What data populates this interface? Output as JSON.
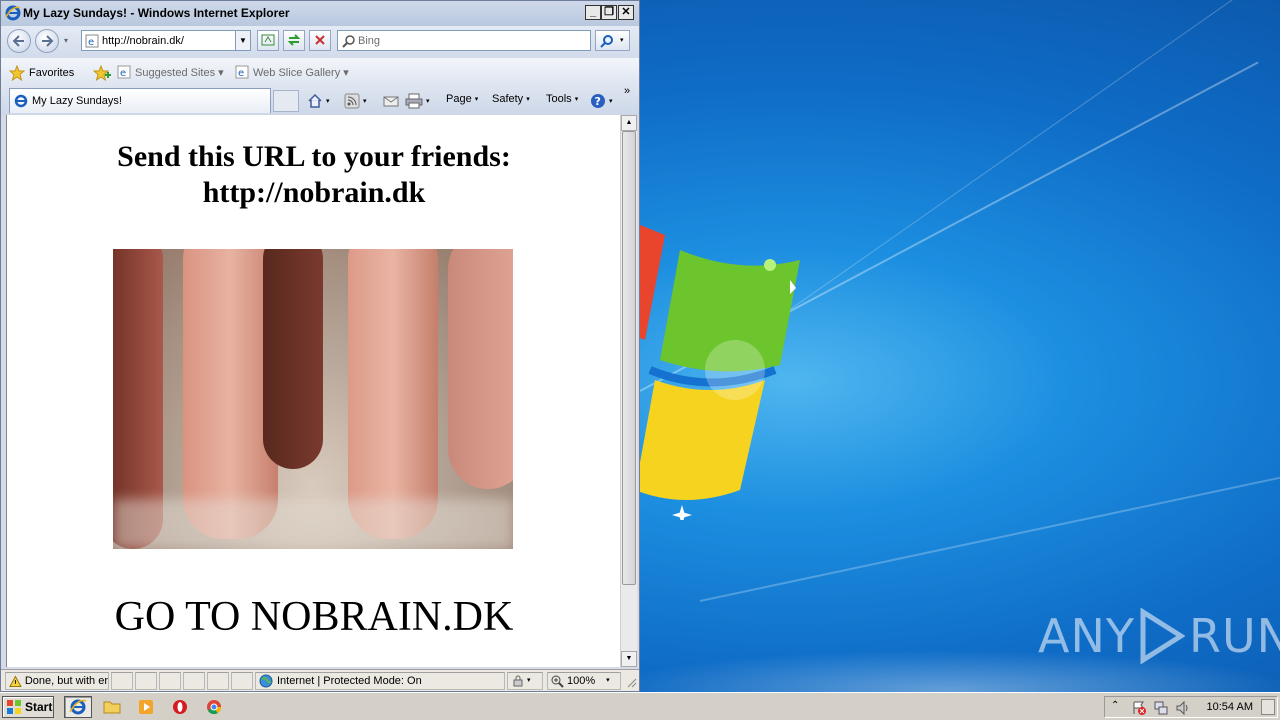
{
  "window": {
    "title": "My Lazy Sundays! - Windows Internet Explorer",
    "minimize_label": "_",
    "restore_label": "❐",
    "close_label": "✕"
  },
  "navbar": {
    "address": "http://nobrain.dk/",
    "search_placeholder": "Bing"
  },
  "favorites_bar": {
    "favorites_label": "Favorites",
    "items": [
      {
        "label": "Suggested Sites ▾"
      },
      {
        "label": "Web Slice Gallery ▾"
      }
    ]
  },
  "tab": {
    "label": "My Lazy Sundays!"
  },
  "command_bar": {
    "page_label": "Page",
    "safety_label": "Safety",
    "tools_label": "Tools",
    "overflow_label": "»"
  },
  "page": {
    "heading_line1": "Send this URL to your friends:",
    "heading_line2": "http://nobrain.dk",
    "goto_text": "GO TO NOBRAIN.DK"
  },
  "status_bar": {
    "status_text": "Done, but with er",
    "zone_text": "Internet | Protected Mode: On",
    "zoom": "100%"
  },
  "taskbar": {
    "start_label": "Start",
    "clock": "10:54 AM"
  },
  "watermark": {
    "text_left": "ANY",
    "text_right": "RUN"
  },
  "colors": {
    "desktop_blue": "#0f6cc6",
    "ie_chrome": "#d6dbe9",
    "taskbar": "#d4d0c8"
  }
}
